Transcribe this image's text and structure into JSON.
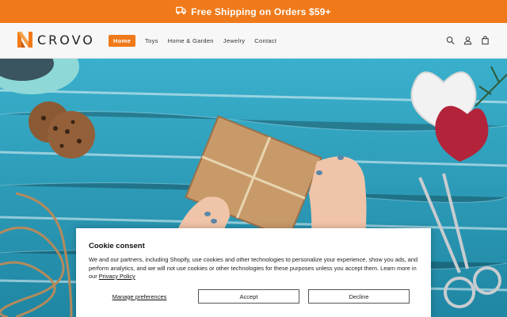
{
  "announcement": {
    "text": "Free Shipping on Orders $59+",
    "icon": "truck-icon"
  },
  "brand": {
    "name": "CROVO",
    "accent": "#f07a1a"
  },
  "nav": {
    "items": [
      {
        "label": "Home",
        "active": true
      },
      {
        "label": "Toys",
        "active": false
      },
      {
        "label": "Home & Garden",
        "active": false
      },
      {
        "label": "Jewelry",
        "active": false
      },
      {
        "label": "Contact",
        "active": false
      }
    ]
  },
  "header_icons": [
    "search-icon",
    "account-icon",
    "cart-icon"
  ],
  "cookie": {
    "title": "Cookie consent",
    "body": "We and our partners, including Shopify, use cookies and other technologies to personalize your experience, show you ads, and perform analytics, and we will not use cookies or other technologies for these purposes unless you accept them. Learn more in our",
    "privacy_link": "Privacy Policy",
    "manage_label": "Manage preferences",
    "accept_label": "Accept",
    "decline_label": "Decline"
  }
}
